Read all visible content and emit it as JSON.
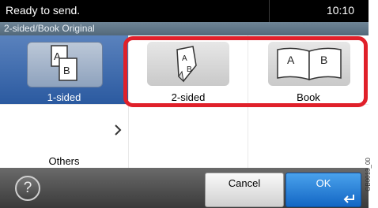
{
  "status": {
    "message": "Ready to send.",
    "time": "10:10"
  },
  "subtitle": "2-sided/Book Original",
  "options": {
    "one_sided": {
      "label": "1-sided",
      "selected": true
    },
    "two_sided": {
      "label": "2-sided",
      "selected": false
    },
    "book": {
      "label": "Book",
      "selected": false
    }
  },
  "others": {
    "label": "Others"
  },
  "buttons": {
    "cancel": "Cancel",
    "ok": "OK"
  },
  "help_glyph": "?",
  "figure_code": "GB0013_00",
  "colors": {
    "selected": "#3a69ad",
    "highlight": "#e0202a",
    "ok": "#1f7fd6"
  },
  "icons": [
    "one-sided-original-icon",
    "two-sided-original-icon",
    "book-original-icon",
    "chevron-right-icon",
    "help-icon",
    "enter-icon"
  ]
}
